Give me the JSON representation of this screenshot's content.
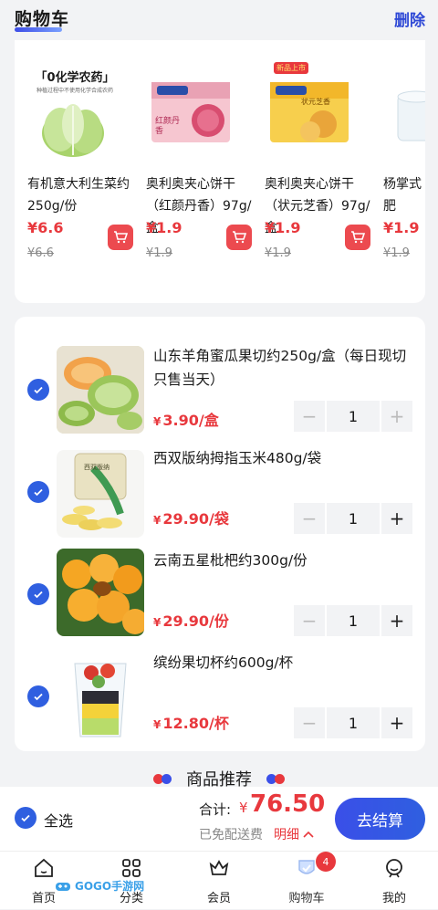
{
  "header": {
    "title": "购物车",
    "delete_label": "删除"
  },
  "recommend_strip": [
    {
      "name": "有机意大利生菜约250g/份",
      "price": "¥6.6",
      "orig": "¥6.6",
      "img_caption": "「0化学农药」",
      "img_sub": "种植过程中不使用化学合成农药"
    },
    {
      "name": "奥利奥夹心饼干（红颜丹香）97g/盒",
      "price": "¥1.9",
      "orig": "¥1.9",
      "img_caption": "红颜丹香"
    },
    {
      "name": "奥利奥夹心饼干（状元芝香）97g/盒",
      "price": "¥1.9",
      "orig": "¥1.9",
      "img_caption": "状元芝香",
      "img_tag": "新品上市"
    },
    {
      "name": "杨掌式肥",
      "price": "¥1.9",
      "orig": "¥1.9"
    }
  ],
  "cart": {
    "items": [
      {
        "name": "山东羊角蜜瓜果切约250g/盒（每日现切 只售当天）",
        "price_symbol": "¥",
        "price": "3.90",
        "unit": "/盒",
        "qty": "1"
      },
      {
        "name": "西双版纳拇指玉米480g/袋",
        "price_symbol": "¥",
        "price": "29.90",
        "unit": "/袋",
        "qty": "1",
        "img_caption": "西双版纳"
      },
      {
        "name": "云南五星枇杷约300g/份",
        "price_symbol": "¥",
        "price": "29.90",
        "unit": "/份",
        "qty": "1"
      },
      {
        "name": "缤纷果切杯约600g/杯",
        "price_symbol": "¥",
        "price": "12.80",
        "unit": "/杯",
        "qty": "1"
      }
    ]
  },
  "recommend_title": "商品推荐",
  "checkout": {
    "select_all": "全选",
    "total_label": "合计:",
    "currency": "¥",
    "total": "76.50",
    "free_shipping": "已免配送费",
    "detail": "明细",
    "pay": "去结算"
  },
  "tabbar": [
    {
      "label": "首页",
      "icon": "home-icon"
    },
    {
      "label": "分类",
      "icon": "category-icon"
    },
    {
      "label": "会员",
      "icon": "crown-icon"
    },
    {
      "label": "购物车",
      "icon": "cart-icon",
      "badge": "4"
    },
    {
      "label": "我的",
      "icon": "profile-icon"
    }
  ],
  "watermark": "GOGO手游网",
  "colors": {
    "accent": "#2f5fe0",
    "price": "#e8383d"
  }
}
